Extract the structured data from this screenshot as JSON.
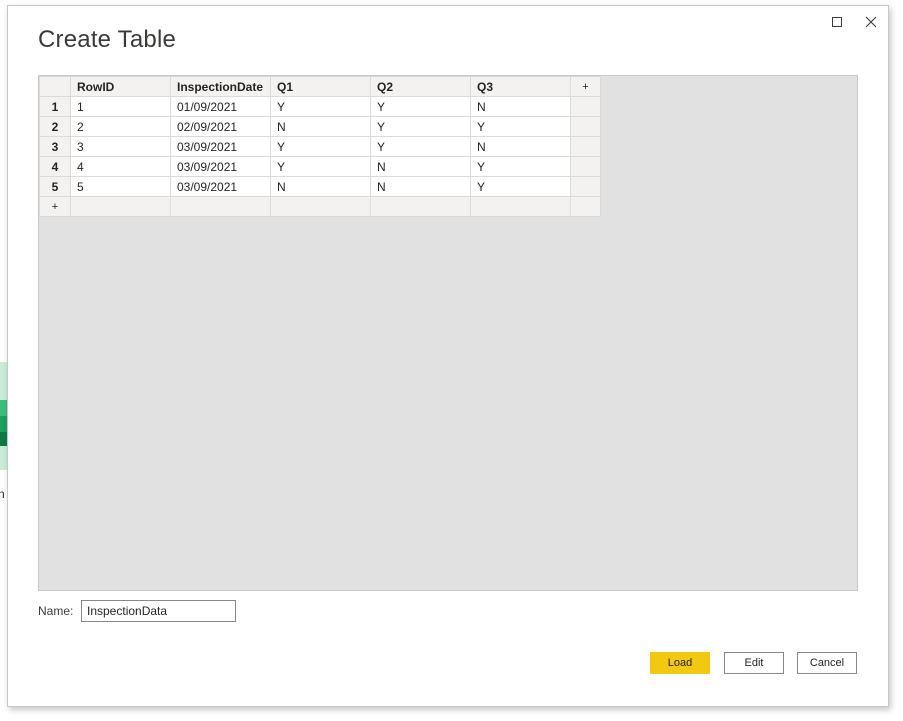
{
  "background": {
    "partial_text": "n",
    "bar_colors": [
      "#c7ecd7",
      "#3dbd7d",
      "#1e9e5f",
      "#0e7a45",
      "#c7ecd7"
    ]
  },
  "dialog": {
    "title": "Create Table",
    "maximize_icon": "maximize-icon",
    "close_icon": "close-icon"
  },
  "table": {
    "add_column_label": "+",
    "add_row_label": "+",
    "columns": [
      "RowID",
      "InspectionDate",
      "Q1",
      "Q2",
      "Q3"
    ],
    "rows": [
      {
        "num": "1",
        "cells": [
          "1",
          "01/09/2021",
          "Y",
          "Y",
          "N"
        ]
      },
      {
        "num": "2",
        "cells": [
          "2",
          "02/09/2021",
          "N",
          "Y",
          "Y"
        ]
      },
      {
        "num": "3",
        "cells": [
          "3",
          "03/09/2021",
          "Y",
          "Y",
          "N"
        ]
      },
      {
        "num": "4",
        "cells": [
          "4",
          "03/09/2021",
          "Y",
          "N",
          "Y"
        ]
      },
      {
        "num": "5",
        "cells": [
          "5",
          "03/09/2021",
          "N",
          "N",
          "Y"
        ]
      }
    ]
  },
  "name_field": {
    "label": "Name:",
    "value": "InspectionData"
  },
  "buttons": {
    "load": "Load",
    "edit": "Edit",
    "cancel": "Cancel"
  },
  "colors": {
    "load_accent": "#f2c811",
    "grid_background": "#e1e1e1"
  }
}
